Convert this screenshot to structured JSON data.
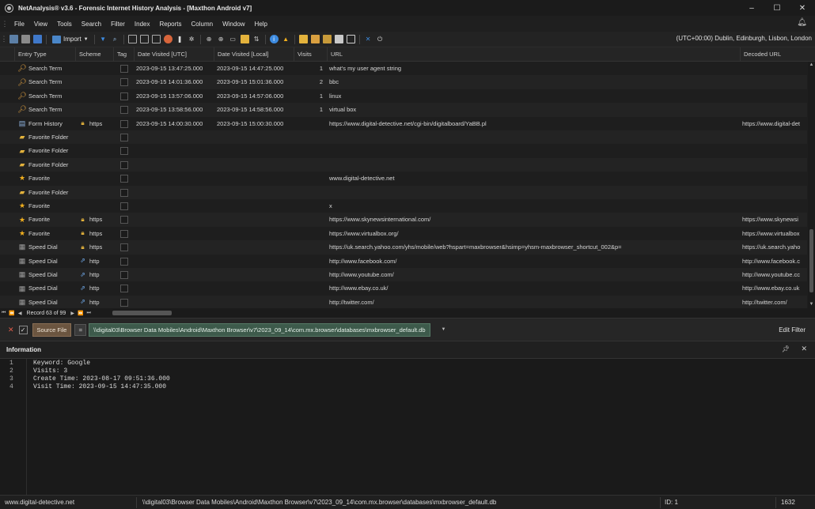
{
  "window": {
    "title": "NetAnalysis® v3.6 - Forensic Internet History Analysis - [Maxthon Android v7]",
    "controls": [
      "–",
      "☐",
      "✕"
    ]
  },
  "menu": [
    "File",
    "View",
    "Tools",
    "Search",
    "Filter",
    "Index",
    "Reports",
    "Column",
    "Window",
    "Help"
  ],
  "toolbar": {
    "import_label": "Import",
    "timezone": "(UTC+00:00) Dublin, Edinburgh, Lisbon, London"
  },
  "columns": [
    "Entry Type",
    "Scheme",
    "Tag",
    "Date Visited [UTC]",
    "Date Visited [Local]",
    "Visits",
    "URL",
    "Decoded URL"
  ],
  "rows": [
    {
      "entry_type": "Search Term",
      "icon": "search-term-icon",
      "scheme": "",
      "scheme_icon": "",
      "date_utc": "2023-09-15 13:47:25.000",
      "date_local": "2023-09-15 14:47:25.000",
      "visits": "1",
      "url": "what's my user agent string",
      "decoded_url": ""
    },
    {
      "entry_type": "Search Term",
      "icon": "search-term-icon",
      "scheme": "",
      "scheme_icon": "",
      "date_utc": "2023-09-15 14:01:36.000",
      "date_local": "2023-09-15 15:01:36.000",
      "visits": "2",
      "url": "bbc",
      "decoded_url": ""
    },
    {
      "entry_type": "Search Term",
      "icon": "search-term-icon",
      "scheme": "",
      "scheme_icon": "",
      "date_utc": "2023-09-15 13:57:06.000",
      "date_local": "2023-09-15 14:57:06.000",
      "visits": "1",
      "url": "linux",
      "decoded_url": ""
    },
    {
      "entry_type": "Search Term",
      "icon": "search-term-icon",
      "scheme": "",
      "scheme_icon": "",
      "date_utc": "2023-09-15 13:58:56.000",
      "date_local": "2023-09-15 14:58:56.000",
      "visits": "1",
      "url": "virtual box",
      "decoded_url": ""
    },
    {
      "entry_type": "Form History",
      "icon": "form-history-icon",
      "scheme": "https",
      "scheme_icon": "lock-icon",
      "date_utc": "2023-09-15 14:00:30.000",
      "date_local": "2023-09-15 15:00:30.000",
      "visits": "",
      "url": "https://www.digital-detective.net/cgi-bin/digitalboard/YaBB.pl",
      "decoded_url": "https://www.digital-det"
    },
    {
      "entry_type": "Favorite Folder",
      "icon": "favorite-folder-icon",
      "scheme": "",
      "scheme_icon": "",
      "date_utc": "",
      "date_local": "",
      "visits": "",
      "url": "",
      "decoded_url": ""
    },
    {
      "entry_type": "Favorite Folder",
      "icon": "favorite-folder-icon",
      "scheme": "",
      "scheme_icon": "",
      "date_utc": "",
      "date_local": "",
      "visits": "",
      "url": "",
      "decoded_url": ""
    },
    {
      "entry_type": "Favorite Folder",
      "icon": "favorite-folder-icon",
      "scheme": "",
      "scheme_icon": "",
      "date_utc": "",
      "date_local": "",
      "visits": "",
      "url": "",
      "decoded_url": ""
    },
    {
      "entry_type": "Favorite",
      "icon": "star-icon",
      "scheme": "",
      "scheme_icon": "",
      "date_utc": "",
      "date_local": "",
      "visits": "",
      "url": "www.digital-detective.net",
      "decoded_url": ""
    },
    {
      "entry_type": "Favorite Folder",
      "icon": "favorite-folder-icon",
      "scheme": "",
      "scheme_icon": "",
      "date_utc": "",
      "date_local": "",
      "visits": "",
      "url": "",
      "decoded_url": ""
    },
    {
      "entry_type": "Favorite",
      "icon": "star-icon",
      "scheme": "",
      "scheme_icon": "",
      "date_utc": "",
      "date_local": "",
      "visits": "",
      "url": "x",
      "decoded_url": ""
    },
    {
      "entry_type": "Favorite",
      "icon": "star-icon",
      "scheme": "https",
      "scheme_icon": "lock-icon",
      "date_utc": "",
      "date_local": "",
      "visits": "",
      "url": "https://www.skynewsinternational.com/",
      "decoded_url": "https://www.skynewsi"
    },
    {
      "entry_type": "Favorite",
      "icon": "star-icon",
      "scheme": "https",
      "scheme_icon": "lock-icon",
      "date_utc": "",
      "date_local": "",
      "visits": "",
      "url": "https://www.virtualbox.org/",
      "decoded_url": "https://www.virtualbox"
    },
    {
      "entry_type": "Speed Dial",
      "icon": "speed-dial-icon",
      "scheme": "https",
      "scheme_icon": "lock-icon",
      "date_utc": "",
      "date_local": "",
      "visits": "",
      "url": "https://uk.search.yahoo.com/yhs/mobile/web?hspart=maxbrowser&hsimp=yhsm-maxbrowser_shortcut_002&p=",
      "decoded_url": "https://uk.search.yaho"
    },
    {
      "entry_type": "Speed Dial",
      "icon": "speed-dial-icon",
      "scheme": "http",
      "scheme_icon": "link-icon",
      "date_utc": "",
      "date_local": "",
      "visits": "",
      "url": "http://www.facebook.com/",
      "decoded_url": "http://www.facebook.c"
    },
    {
      "entry_type": "Speed Dial",
      "icon": "speed-dial-icon",
      "scheme": "http",
      "scheme_icon": "link-icon",
      "date_utc": "",
      "date_local": "",
      "visits": "",
      "url": "http://www.youtube.com/",
      "decoded_url": "http://www.youtube.cc"
    },
    {
      "entry_type": "Speed Dial",
      "icon": "speed-dial-icon",
      "scheme": "http",
      "scheme_icon": "link-icon",
      "date_utc": "",
      "date_local": "",
      "visits": "",
      "url": "http://www.ebay.co.uk/",
      "decoded_url": "http://www.ebay.co.uk"
    },
    {
      "entry_type": "Speed Dial",
      "icon": "speed-dial-icon",
      "scheme": "http",
      "scheme_icon": "link-icon",
      "date_utc": "",
      "date_local": "",
      "visits": "",
      "url": "http://twitter.com/",
      "decoded_url": "http://twitter.com/"
    }
  ],
  "navigator": {
    "record_text": "Record 63 of 99"
  },
  "filter": {
    "source_label": "Source File",
    "operator": "=",
    "path": "\\\\digital03\\Browser Data Mobiles\\Android\\Maxthon Browser\\v7\\2023_09_14\\com.mx.browser\\databases\\mxbrowser_default.db",
    "edit_label": "Edit Filter"
  },
  "info": {
    "title": "Information",
    "lines": [
      {
        "n": "1",
        "text": "Keyword: Google"
      },
      {
        "n": "2",
        "text": "Visits: 3"
      },
      {
        "n": "3",
        "text": "Create Time: 2023-08-17 09:51:36.000"
      },
      {
        "n": "4",
        "text": "Visit Time: 2023-09-15 14:47:35.000"
      }
    ]
  },
  "status": {
    "site": "www.digital-detective.net",
    "path": "\\\\digital03\\Browser Data Mobiles\\Android\\Maxthon Browser\\v7\\2023_09_14\\com.mx.browser\\databases\\mxbrowser_default.db",
    "id": "ID: 1",
    "count": "1632"
  },
  "colors": {
    "accent_source": "#6b5540",
    "accent_path": "#3d5a4b",
    "close_red": "#e35d4a",
    "star": "#f2b01e"
  }
}
